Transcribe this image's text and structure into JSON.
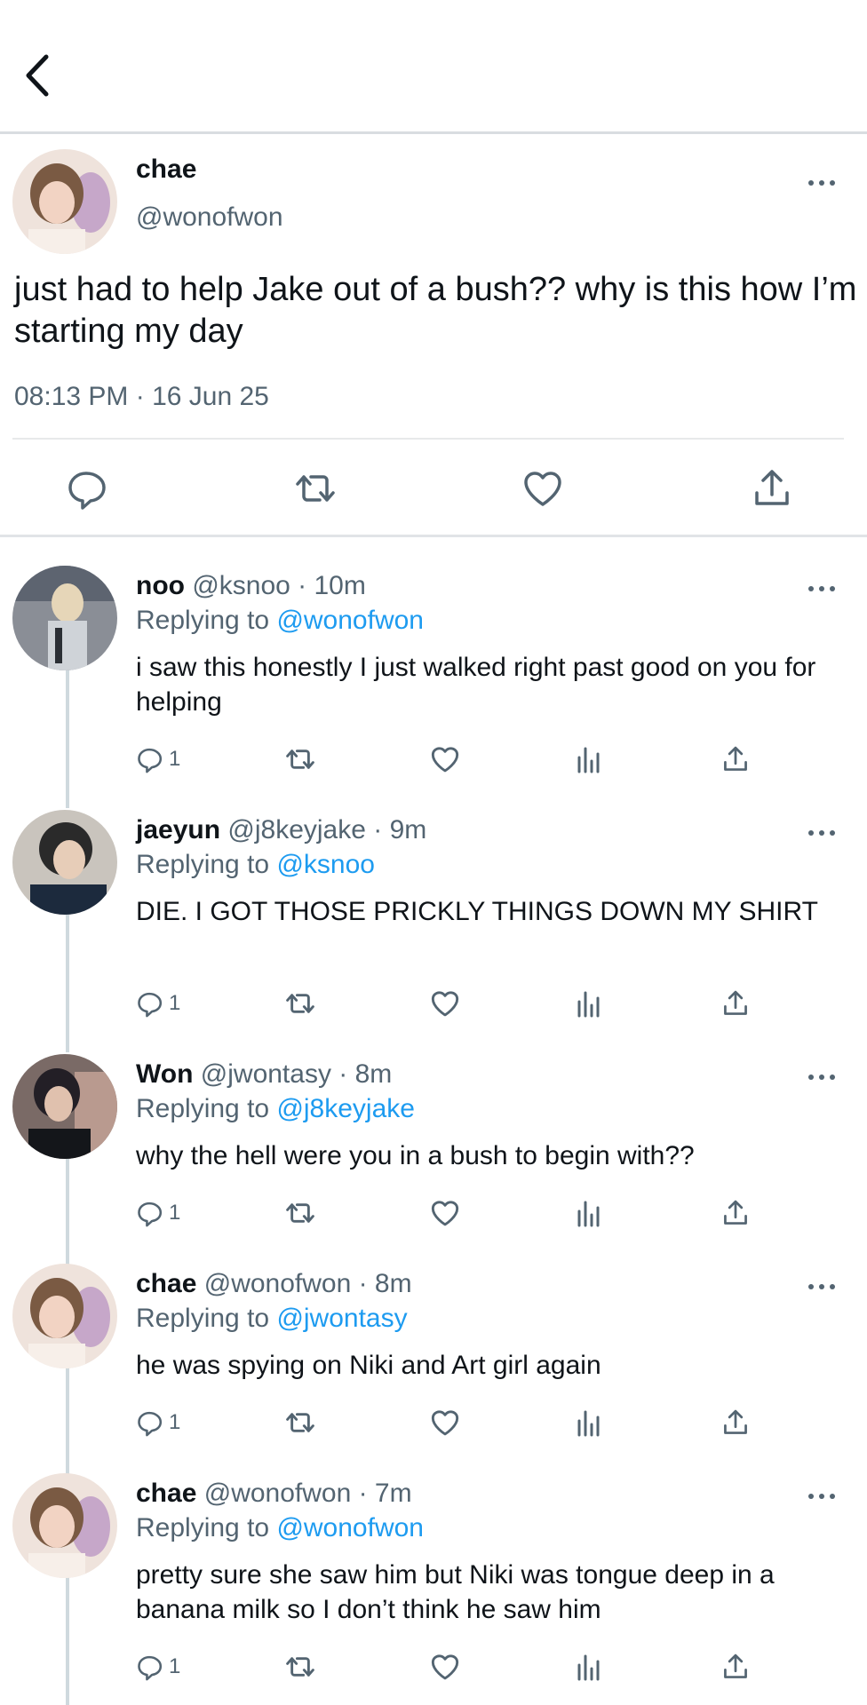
{
  "header": {
    "back_icon": "chevron-left-icon"
  },
  "main_tweet": {
    "name": "chae",
    "handle": "@wonofwon",
    "text": "just had to help Jake out of a bush?? why is this how I’m starting my day",
    "timestamp": "08:13 PM · 16 Jun 25",
    "actions": [
      "reply-icon",
      "retweet-icon",
      "like-icon",
      "share-icon"
    ]
  },
  "replies": [
    {
      "name": "noo",
      "meta": "@ksnoo · 10m",
      "replying_prefix": "Replying to",
      "replying_to": "@wonofwon",
      "text": "i saw this honestly I just walked right past good on you for helping",
      "reply_count": "1"
    },
    {
      "name": "jaeyun",
      "meta": "@j8keyjake · 9m",
      "replying_prefix": "Replying to",
      "replying_to": "@ksnoo",
      "text": "DIE. I GOT THOSE PRICKLY THINGS  DOWN MY SHIRT",
      "reply_count": "1"
    },
    {
      "name": "Won",
      "meta": "@jwontasy · 8m",
      "replying_prefix": "Replying to",
      "replying_to": "@j8keyjake",
      "text": "why the hell were you in a bush to begin with??",
      "reply_count": "1"
    },
    {
      "name": "chae",
      "meta": "@wonofwon · 8m",
      "replying_prefix": "Replying to",
      "replying_to": "@jwontasy",
      "text": "he was spying on Niki and Art girl again",
      "reply_count": "1"
    },
    {
      "name": "chae",
      "meta": "@wonofwon · 7m",
      "replying_prefix": "Replying to",
      "replying_to": "@wonofwon",
      "text": "pretty sure she saw him but Niki was tongue deep in a banana milk so I don’t think he saw him",
      "reply_count": "1"
    }
  ],
  "colors": {
    "text": "#0f1419",
    "secondary": "#536471",
    "link": "#1d9bf0",
    "divider": "#e7e9ea"
  }
}
